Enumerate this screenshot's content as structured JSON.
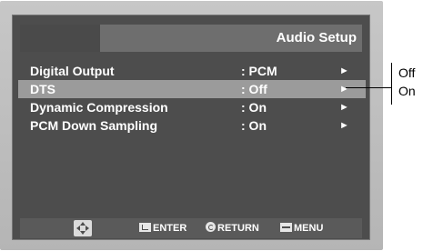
{
  "header": {
    "title": "Audio Setup"
  },
  "menu": {
    "items": [
      {
        "label": "Digital Output",
        "value": ": PCM",
        "arrow": "►"
      },
      {
        "label": "DTS",
        "value": ": Off",
        "arrow": "►"
      },
      {
        "label": "Dynamic Compression",
        "value": ": On",
        "arrow": "►"
      },
      {
        "label": "PCM Down Sampling",
        "value": ": On",
        "arrow": "►"
      }
    ],
    "selected_index": 1
  },
  "footer": {
    "nav_icon": "direction-pad-icon",
    "enter_label": "ENTER",
    "return_label": "RETURN",
    "menu_label": "MENU"
  },
  "callout": {
    "options": [
      "Off",
      "On"
    ]
  },
  "colors": {
    "screen_bg": "#4d4d4d",
    "header_bg": "#6e6e6e",
    "selected_bg": "#9b9b9b",
    "text": "#ffffff"
  }
}
